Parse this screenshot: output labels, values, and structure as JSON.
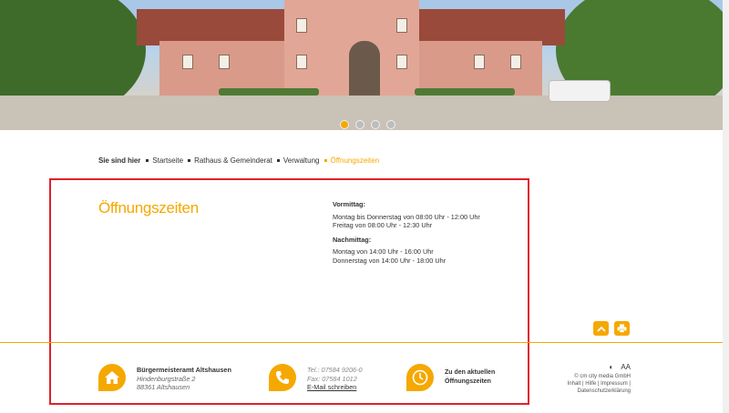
{
  "hero": {
    "slider_dots": [
      {
        "active": true
      },
      {
        "active": false
      },
      {
        "active": false
      },
      {
        "active": false
      }
    ]
  },
  "breadcrumb": {
    "lead": "Sie sind hier",
    "items": [
      {
        "label": "Startseite"
      },
      {
        "label": "Rathaus & Gemeinderat"
      },
      {
        "label": "Verwaltung"
      },
      {
        "label": "Öffnungszeiten"
      }
    ]
  },
  "main": {
    "title": "Öffnungszeiten",
    "morning": {
      "heading": "Vormittag:",
      "lines": [
        "Montag bis Donnerstag von 08:00 Uhr - 12:00 Uhr",
        "Freitag von 08:00 Uhr - 12:30 Uhr"
      ]
    },
    "afternoon": {
      "heading": "Nachmittag:",
      "lines": [
        "Montag von 14:00 Uhr - 16:00 Uhr",
        "Donnerstag von 14:00 Uhr - 18:00 Uhr"
      ]
    }
  },
  "footer": {
    "address": {
      "name": "Bürgermeisteramt Altshausen",
      "street": "Hindenburgstraße 2",
      "city": "88361 Altshausen"
    },
    "contact": {
      "tel": "Tel.: 07584 9206-0",
      "fax": "Fax: 07584 1012",
      "email_link": "E-Mail schreiben"
    },
    "hours_link": {
      "line1": "Zu den aktuellen",
      "line2": "Öffnungszeiten"
    },
    "meta": {
      "contrast_symbol": "◐",
      "font_size_symbol": "AA",
      "copyright": "© cm city media GmbH",
      "links_line1": "Inhalt | Hilfe | Impressum |",
      "links_line2": "Datenschutzerklärung"
    }
  },
  "colors": {
    "accent": "#f5a800",
    "frame": "#e0202a"
  },
  "icons": [
    "home-icon",
    "phone-icon",
    "clock-icon",
    "arrow-up-icon",
    "print-icon",
    "contrast-icon"
  ]
}
